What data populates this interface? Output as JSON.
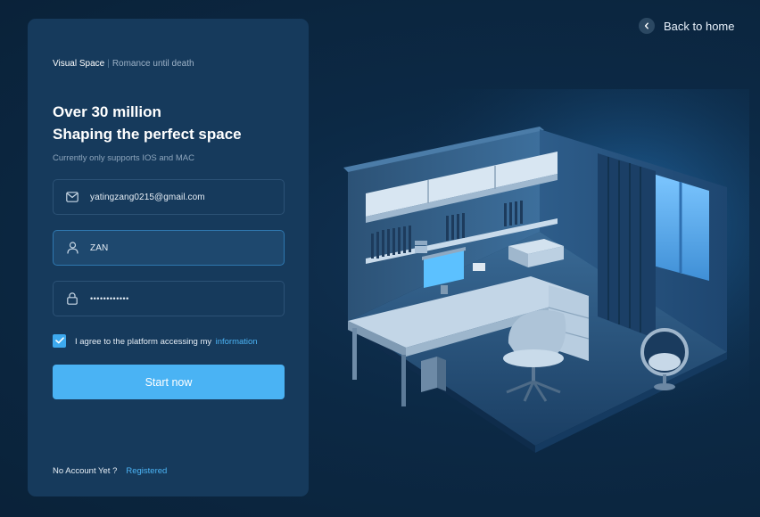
{
  "nav": {
    "back_label": "Back to home",
    "back_icon": "chevron-left-icon"
  },
  "brand": {
    "name": "Visual Space",
    "separator": "|",
    "tagline": "Romance until death"
  },
  "hero": {
    "title_line1": "Over 30 million",
    "title_line2": "Shaping the perfect space",
    "subtitle": "Currently only supports IOS and MAC"
  },
  "form": {
    "email": {
      "value": "yatingzang0215@gmail.com",
      "icon": "mail-icon"
    },
    "username": {
      "value": "ZAN",
      "icon": "user-icon"
    },
    "password": {
      "value": "••••••••••••",
      "icon": "lock-icon"
    },
    "agree": {
      "checked": true,
      "text": "I agree to the platform accessing my",
      "link": "information"
    },
    "submit_label": "Start now"
  },
  "footer": {
    "text": "No Account Yet ?",
    "link": "Registered"
  },
  "colors": {
    "background": "#0b2540",
    "panel": "#163a5c",
    "accent": "#4ab3f4",
    "link": "#4cb4f5"
  }
}
